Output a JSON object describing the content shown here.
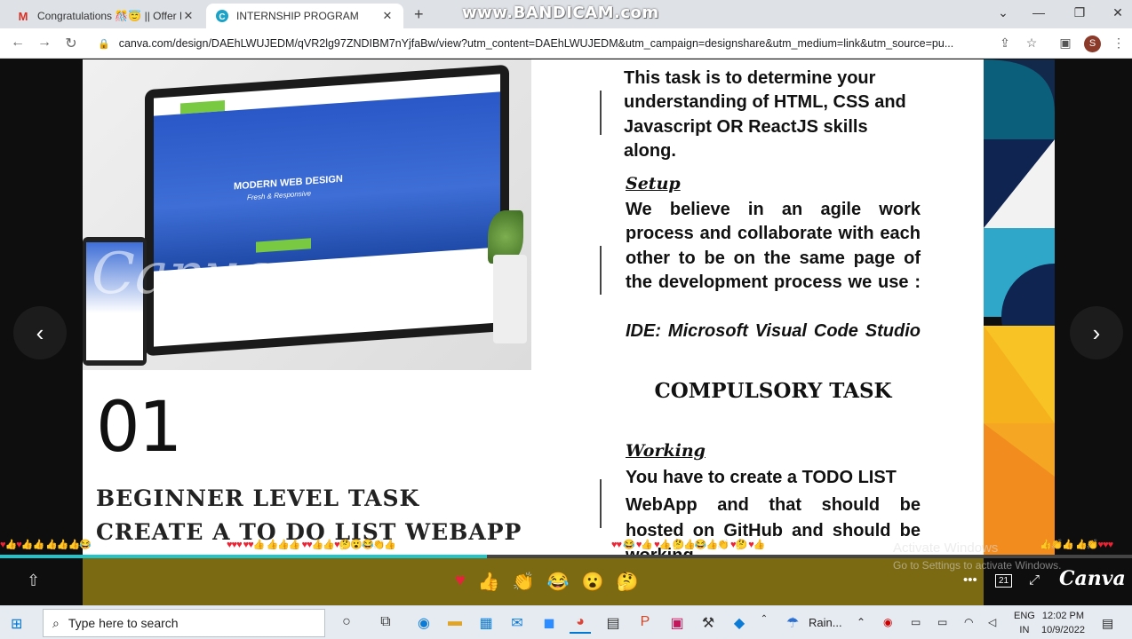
{
  "browser": {
    "tabs": [
      {
        "title": "Congratulations 🎊😇 || Offer Le",
        "icon": "gmail-icon"
      },
      {
        "title": "INTERNSHIP PROGRAM",
        "icon": "canva-icon",
        "active": true
      }
    ],
    "watermark": "www.BANDICAM.com",
    "url": "canva.com/design/DAEhLWUJEDM/qVR2lg97ZNDIBM7nYjfaBw/view?utm_content=DAEhLWUJEDM&utm_campaign=designshare&utm_medium=link&utm_source=pu...",
    "profile_initial": "S"
  },
  "slide": {
    "mockup": {
      "site_title": "MODERN WEB DESIGN",
      "site_subtitle": "Fresh & Responsive",
      "watermark": "Canva"
    },
    "number": "01",
    "heading_line1": "BEGINNER LEVEL TASK",
    "heading_line2": "CREATE A TO DO LIST WEBAPP",
    "intro": "This task is to determine your understanding of HTML, CSS and Javascript OR ReactJS skills along.",
    "setup": {
      "heading": "Setup ",
      "body": "We believe in an agile work process and collaborate with each other to be on the same page of the development process we use :",
      "ide": "IDE: Microsoft Visual Code Studio"
    },
    "compulsory_title": "COMPULSORY TASK",
    "working": {
      "heading": "Working ",
      "line1": "You have to create a TODO LIST",
      "body": "WebApp and that should be hosted on GitHub and should be",
      "tail": "working"
    }
  },
  "viewer": {
    "reactions_left": "♥👍♥👍👍 👍👍👍😂",
    "reactions_mid": "♥♥♥ ♥♥👍 👍👍👍 ♥♥👍👍♥🤔😮😂👏👍",
    "reactions_right": "♥♥ 😂 ♥👍 ♥👍 🤔👍😂👍👏 ♥🤔 ♥👍",
    "reactions_far": "👍👏👍 👍👏♥♥♥",
    "emoji_bar": [
      "♥",
      "👍",
      "👏",
      "😂",
      "😮",
      "🤔"
    ],
    "progress": 0.43,
    "windows_activate_title": "Activate Windows",
    "windows_activate_sub": "Go to Settings to activate Windows.",
    "brand": "Canva",
    "page_indicator": "21"
  },
  "taskbar": {
    "search_placeholder": "Type here to search",
    "weather": "Rain...",
    "language": "ENG",
    "region": "IN",
    "time": "12:02 PM",
    "date": "10/9/2022"
  }
}
